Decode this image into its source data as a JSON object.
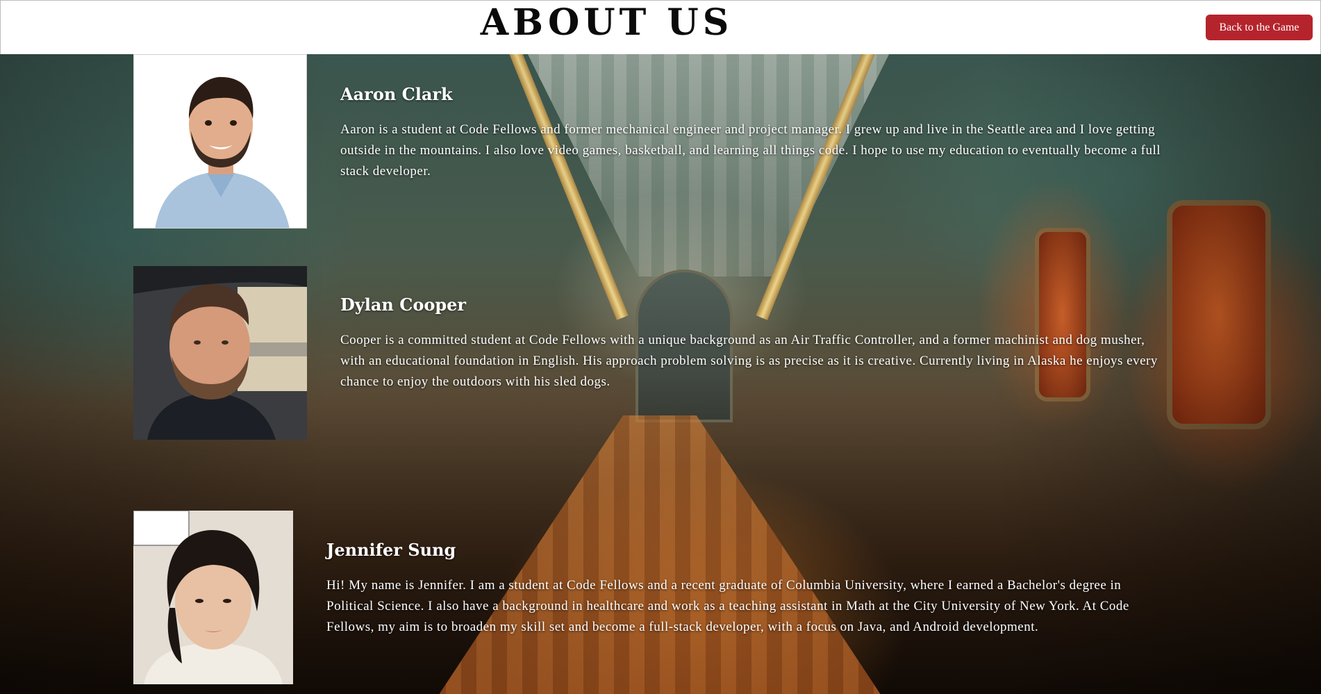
{
  "header": {
    "title": "ABOUT US",
    "back_button_label": "Back to the Game",
    "back_button_color": "#b5242c"
  },
  "background": {
    "description_icon": "train-interior-background"
  },
  "members": [
    {
      "name": "Aaron Clark",
      "bio": "Aaron is a student at Code Fellows and former mechanical engineer and project manager. I grew up and live in the Seattle area and I love getting outside in the mountains. I also love video games, basketball, and learning all things code. I hope to use my education to eventually become a full stack developer.",
      "photo_icon": "aaron-clark-portrait"
    },
    {
      "name": "Dylan Cooper",
      "bio": "Cooper is a committed student at Code Fellows with a unique background as an Air Traffic Controller, and a former machinist and dog musher, with an educational foundation in English. His approach problem solving is as precise as it is creative. Currently living in Alaska he enjoys every chance to enjoy the outdoors with his sled dogs.",
      "photo_icon": "dylan-cooper-portrait"
    },
    {
      "name": "Jennifer Sung",
      "bio": "Hi! My name is Jennifer. I am a student at Code Fellows and a recent graduate of Columbia University, where I earned a Bachelor's degree in Political Science. I also have a background in healthcare and work as a teaching assistant in Math at the City University of New York. At Code Fellows, my aim is to broaden my skill set and become a full-stack developer, with a focus on Java, and Android development.",
      "photo_icon": "jennifer-sung-portrait"
    }
  ]
}
